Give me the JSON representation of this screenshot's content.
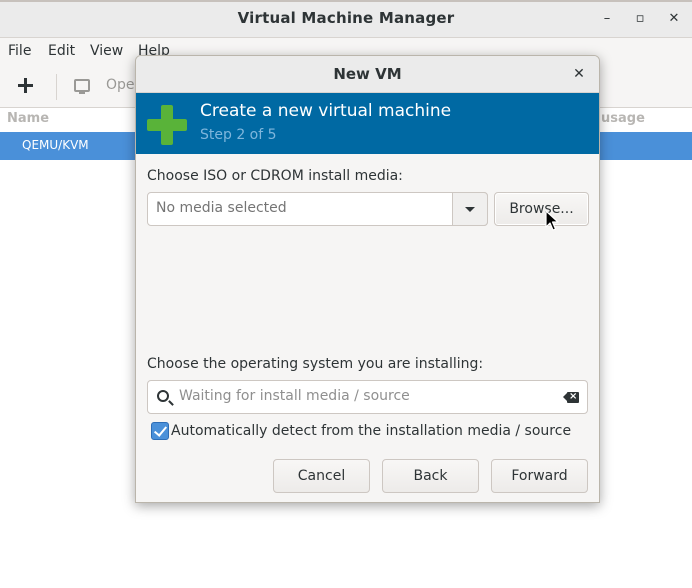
{
  "main_window": {
    "title": "Virtual Machine Manager",
    "controls": {
      "minimize": "–",
      "maximize": "▫",
      "close": "✕"
    },
    "menu": [
      "File",
      "Edit",
      "View",
      "Help"
    ],
    "toolbar": {
      "open_label": "Ope"
    },
    "list": {
      "columns": {
        "name": "Name",
        "usage": "usage"
      },
      "rows": [
        {
          "name": "QEMU/KVM",
          "selected": true
        }
      ]
    }
  },
  "dialog": {
    "title": "New VM",
    "close": "✕",
    "header": {
      "title": "Create a new virtual machine",
      "step": "Step 2 of 5",
      "icon": "plus-icon",
      "background_color": "#0069a3",
      "icon_color": "#59b339"
    },
    "install_media": {
      "label": "Choose ISO or CDROM install media:",
      "placeholder": "No media selected",
      "browse_label": "Browse..."
    },
    "os": {
      "label": "Choose the operating system you are installing:",
      "placeholder": "Waiting for install media / source"
    },
    "auto_detect": {
      "label": "Automatically detect from the installation media / source",
      "checked": true
    },
    "buttons": {
      "cancel": "Cancel",
      "back": "Back",
      "forward": "Forward"
    }
  },
  "colors": {
    "selection": "#4a90d9",
    "window_bg": "#f6f5f4"
  }
}
